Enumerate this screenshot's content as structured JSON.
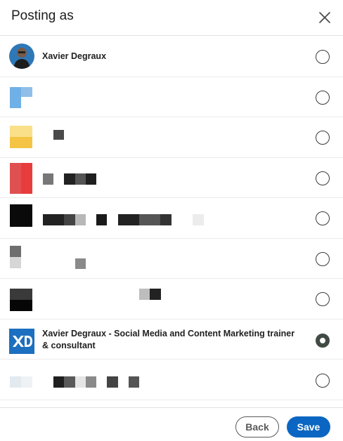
{
  "dialog": {
    "title": "Posting as",
    "close_icon": "close-icon"
  },
  "accounts": [
    {
      "name": "Xavier Degraux",
      "selected": false
    },
    {
      "name": "",
      "selected": false
    },
    {
      "name": "",
      "selected": false
    },
    {
      "name": "",
      "selected": false
    },
    {
      "name": "",
      "selected": false
    },
    {
      "name": "",
      "selected": false
    },
    {
      "name": "",
      "selected": false
    },
    {
      "name": "Xavier Degraux - Social Media and Content Marketing trainer & consultant",
      "selected": true
    },
    {
      "name": "",
      "selected": false
    }
  ],
  "footer": {
    "back_label": "Back",
    "save_label": "Save"
  },
  "colors": {
    "primary": "#0a66c2",
    "radio_checked": "#404b44"
  }
}
